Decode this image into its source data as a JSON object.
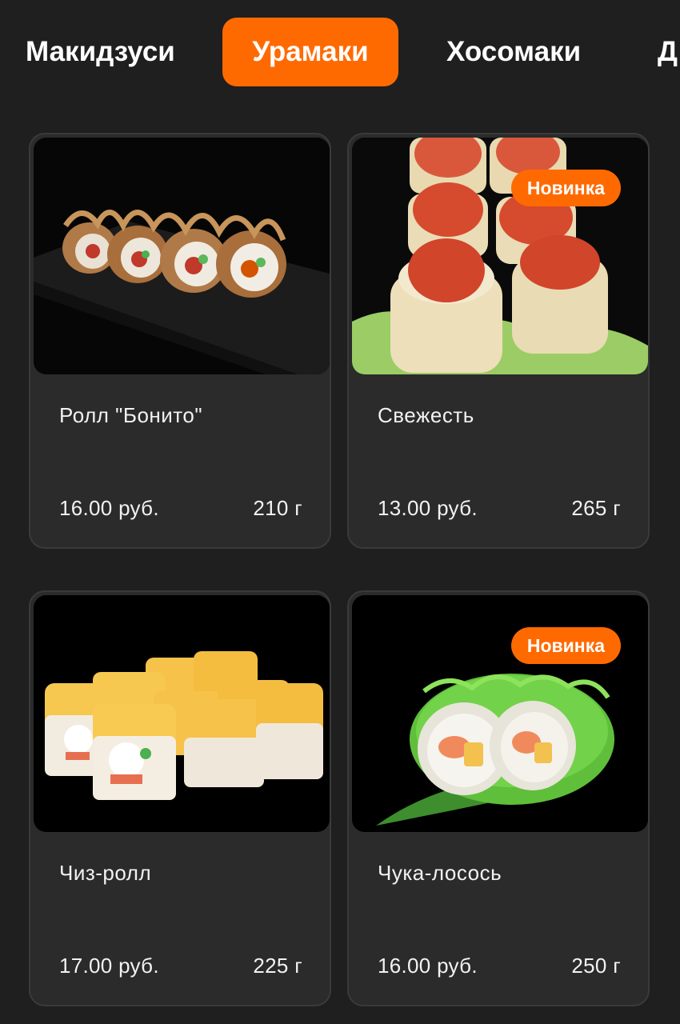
{
  "tabs": [
    {
      "label": "Макидзуси",
      "active": false
    },
    {
      "label": "Урамаки",
      "active": true
    },
    {
      "label": "Хосомаки",
      "active": false
    },
    {
      "label": "Д",
      "active": false
    }
  ],
  "products": [
    {
      "name": "Ролл \"Бонито\"",
      "price": "16.00 руб.",
      "weight": "210 г",
      "badge": null
    },
    {
      "name": "Свежесть",
      "price": "13.00 руб.",
      "weight": "265 г",
      "badge": "Новинка"
    },
    {
      "name": "Чиз-ролл",
      "price": "17.00 руб.",
      "weight": "225 г",
      "badge": null
    },
    {
      "name": "Чука-лосось",
      "price": "16.00 руб.",
      "weight": "250 г",
      "badge": "Новинка"
    }
  ],
  "colors": {
    "accent": "#ff6a00",
    "background": "#1f1f1f",
    "card": "#2b2b2b"
  }
}
